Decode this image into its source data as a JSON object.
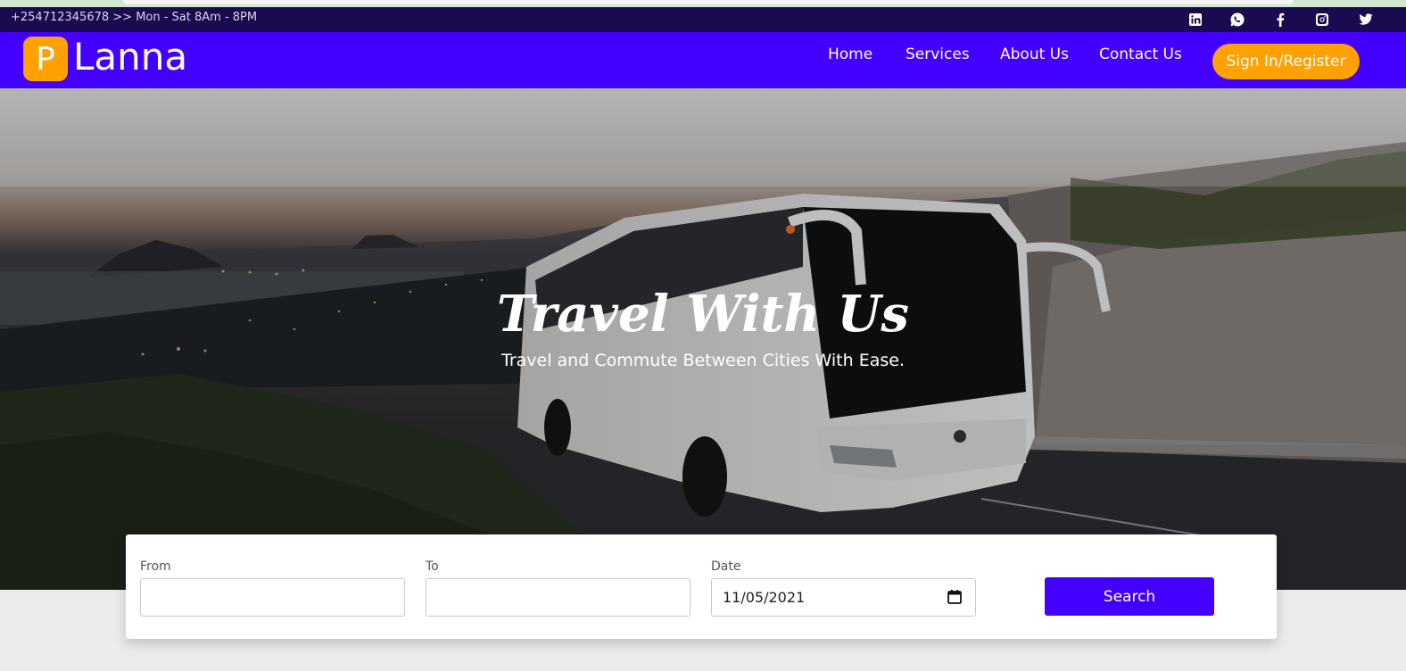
{
  "topbar": {
    "contact": "+254712345678 >> Mon - Sat 8Am - 8PM",
    "social": [
      "linkedin-icon",
      "whatsapp-icon",
      "facebook-icon",
      "instagram-icon",
      "twitter-icon"
    ]
  },
  "brand": {
    "badge": "P",
    "name": "Lanna"
  },
  "nav": {
    "links": [
      "Home",
      "Services",
      "About Us",
      "Contact Us"
    ],
    "signin": "Sign In/Register"
  },
  "hero": {
    "title": "Travel With Us",
    "subtitle": "Travel and Commute Between Cities With Ease."
  },
  "search": {
    "from_label": "From",
    "from_value": "",
    "to_label": "To",
    "to_value": "",
    "date_label": "Date",
    "date_value": "11/05/2021",
    "button": "Search"
  },
  "colors": {
    "primary": "#4300ff",
    "accent": "#ffa100",
    "topbar": "#1a0a50"
  }
}
